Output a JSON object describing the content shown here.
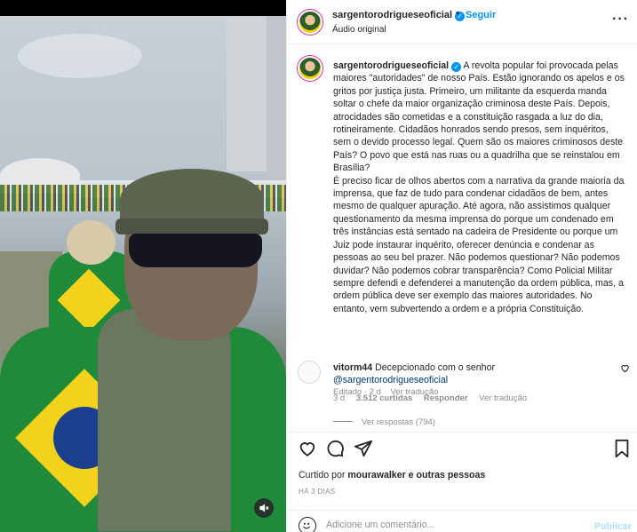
{
  "header": {
    "username": "sargentorodrigueseoficial",
    "separator": "•",
    "follow_label": "Seguir",
    "subtitle": "Áudio original",
    "more_icon": "more-horizontal-icon"
  },
  "caption": {
    "username": "sargentorodrigueseoficial",
    "text": "A revolta popular foi provocada pelas maiores \"autoridades\" de nosso País. Estão ignorando os apelos e os gritos por justiça justa. Primeiro, um militante da esquerda manda soltar o chefe da maior organização criminosa deste País. Depois, atrocidades são cometidas e a constituição rasgada a luz do dia, rotineiramente. Cidadãos honrados sendo presos, sem inquéritos, sem o devido processo legal. Quem são os maiores criminosos deste País? O povo que está nas ruas ou a quadrilha que se reinstalou em Brasília?\nÉ preciso ficar de olhos abertos com a narrativa da grande maioria da imprensa, que faz de tudo para condenar cidadãos de bem, antes mesmo de qualquer apuração. Até agora, não assistimos qualquer questionamento da mesma imprensa do porque um condenado em três instâncias está sentado na cadeira de Presidente ou porque um Juiz pode instaurar inquérito, oferecer denúncia e condenar as pessoas ao seu bel prazer. Não podemos questionar? Não podemos duvidar? Não podemos cobrar transparência? Como Policial Militar sempre defendi e defenderei a manutenção da ordem pública, mas, a ordem pública deve ser exemplo das maiores autoridades. No entanto, vem subvertendo a ordem e a própria Constituição.",
    "edited": "Editado · 2 d",
    "translate": "Ver tradução"
  },
  "comment": {
    "username": "vitorm44",
    "text": "Decepcionado com o senhor",
    "mention": "@sargentorodrigueseoficial",
    "time": "3 d",
    "likes": "3.512 curtidas",
    "reply": "Responder",
    "translate": "Ver tradução",
    "view_replies": "Ver respostas (794)"
  },
  "actions": {
    "like_icon": "heart-icon",
    "comment_icon": "comment-icon",
    "share_icon": "send-icon",
    "save_icon": "bookmark-icon"
  },
  "likes": {
    "prefix": "Curtido por",
    "user": "mourawalker",
    "suffix": "e outras pessoas"
  },
  "posted_ago": "HÁ 3 DIAS",
  "add_comment": {
    "placeholder": "Adicione um comentário...",
    "publish": "Publicar"
  },
  "colors": {
    "accent": "#0095f6",
    "muted": "#8e8e8e",
    "publish_disabled": "#b2dffc"
  }
}
